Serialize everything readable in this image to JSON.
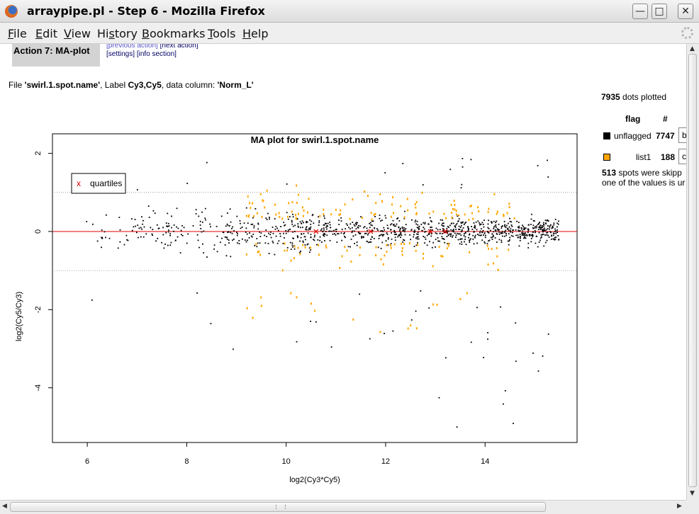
{
  "window": {
    "title": "arraypipe.pl - Step 6 - Mozilla Firefox",
    "minimize": "—",
    "maximize": "□",
    "close": "✕"
  },
  "menu": {
    "items": [
      {
        "key": "F",
        "rest": "ile"
      },
      {
        "key": "E",
        "rest": "dit"
      },
      {
        "key": "V",
        "rest": "iew"
      },
      {
        "key": "",
        "pre": "Hi",
        "key2": "s",
        "rest": "tory"
      },
      {
        "key": "B",
        "rest": "ookmarks"
      },
      {
        "key": "T",
        "rest": "ools"
      },
      {
        "key": "H",
        "rest": "elp"
      }
    ]
  },
  "action": {
    "title": "Action 7: MA-plot",
    "prev": "[previous action]",
    "next": "[next action]",
    "settings": "[settings]",
    "info": "[info section]"
  },
  "fileline": {
    "p1": "File ",
    "file": "'swirl.1.spot.name'",
    "p2": ", Label ",
    "label": "Cy3,Cy5",
    "p3": ", data column: ",
    "column": "'Norm_L'"
  },
  "stats": {
    "dots_count": "7935",
    "dots_text": " dots plotted",
    "flag_header": "flag",
    "count_header": "#",
    "rows": [
      {
        "name": "unflagged",
        "count": "7747",
        "color": "#000000",
        "input": "b"
      },
      {
        "name": "list1",
        "count": "188",
        "color": "#ffa500",
        "input": "c"
      }
    ],
    "skipped_count": "513",
    "skipped_line1": " spots were skipp",
    "skipped_line2": "one of the values is ur"
  },
  "chart_data": {
    "type": "scatter",
    "title": "MA plot for swirl.1.spot.name",
    "xlabel": "log2(Cy3*Cy5)",
    "ylabel": "log2(Cy5/Cy3)",
    "xlim": [
      5.3,
      15.85
    ],
    "ylim": [
      -5.4,
      2.5
    ],
    "xticks": [
      "6",
      "8",
      "10",
      "12",
      "14"
    ],
    "yticks": [
      "2",
      "0",
      "-2",
      "-4"
    ],
    "hlines": [
      1,
      -1
    ],
    "zero_line": 0,
    "legend": {
      "position": "top-left",
      "marker": "x",
      "label": "quartiles"
    },
    "quartile_markers": [
      {
        "x": 10.6,
        "y": 0
      },
      {
        "x": 11.7,
        "y": 0
      },
      {
        "x": 12.9,
        "y": 0
      },
      {
        "x": 13.2,
        "y": 0
      }
    ],
    "series": [
      {
        "name": "unflagged",
        "count": 7747,
        "color": "#000000"
      },
      {
        "name": "list1",
        "count": 188,
        "color": "#ffa500"
      }
    ]
  }
}
